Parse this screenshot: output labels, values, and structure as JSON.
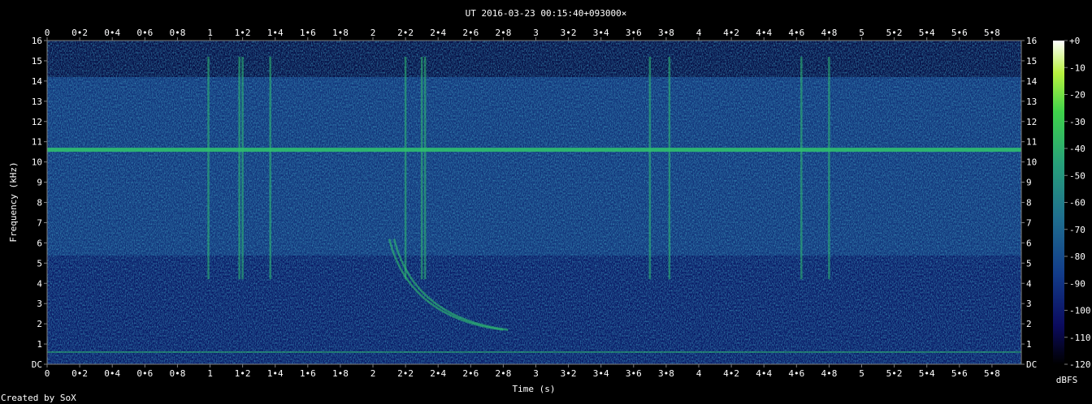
{
  "title": "UT 2016-03-23 00:15:40+093000×",
  "credit": "Created by SoX",
  "colors": {
    "background": "#000000",
    "text": "#ffffff",
    "axis": "#7f7f7f",
    "noise_floor": "#0a1a66",
    "hum_line": "#2fbf6f",
    "colorbar_stops": [
      "#000000",
      "#0b0b5e",
      "#123c8a",
      "#1f6e8f",
      "#27a07a",
      "#3fd24a",
      "#b8f23f",
      "#ffffff"
    ]
  },
  "chart_data": {
    "type": "heatmap",
    "title": "UT 2016-03-23 00:15:40+093000×",
    "xlabel": "Time (s)",
    "ylabel": "Frequency (kHz)",
    "xlim": [
      0,
      5.98
    ],
    "ylim": [
      0,
      16
    ],
    "x_ticks": [
      "0",
      "0•2",
      "0•4",
      "0•6",
      "0•8",
      "1",
      "1•2",
      "1•4",
      "1•6",
      "1•8",
      "2",
      "2•2",
      "2•4",
      "2•6",
      "2•8",
      "3",
      "3•2",
      "3•4",
      "3•6",
      "3•8",
      "4",
      "4•2",
      "4•4",
      "4•6",
      "4•8",
      "5",
      "5•2",
      "5•4",
      "5•6",
      "5•8"
    ],
    "y_ticks": [
      "DC",
      "1",
      "2",
      "3",
      "4",
      "5",
      "6",
      "7",
      "8",
      "9",
      "10",
      "11",
      "12",
      "13",
      "14",
      "15",
      "16"
    ],
    "colorbar": {
      "label": "dBFS",
      "ticks": [
        "+0",
        "-10",
        "-20",
        "-30",
        "-40",
        "-50",
        "-60",
        "-70",
        "-80",
        "-90",
        "-100",
        "-110",
        "-120"
      ],
      "range": [
        -120,
        0
      ]
    },
    "features": {
      "horizontal_tone_khz": 10.6,
      "low_tone_khz": 0.6,
      "vertical_impulses_s": [
        0.99,
        1.18,
        1.2,
        1.37,
        2.2,
        2.3,
        2.32,
        3.7,
        3.82,
        4.63,
        4.8
      ],
      "whistler": {
        "start_s": 2.1,
        "end_s": 2.8,
        "start_khz": 6.2,
        "end_khz": 1.7
      }
    }
  }
}
